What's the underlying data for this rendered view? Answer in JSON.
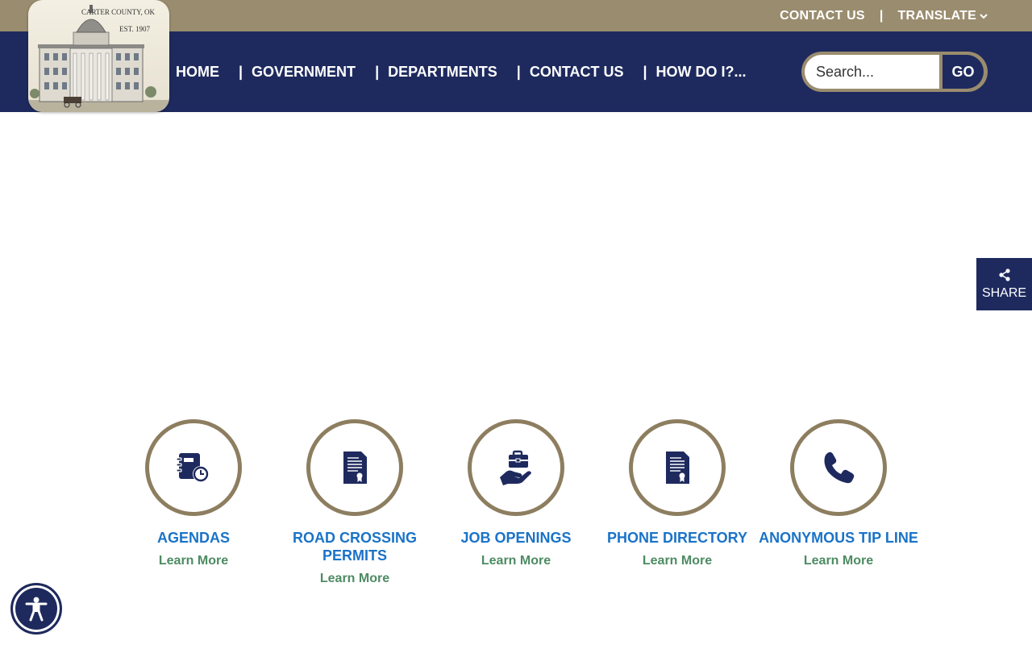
{
  "utility": {
    "contact_label": "CONTACT US",
    "separator": "|",
    "translate_label": "TRANSLATE"
  },
  "logo": {
    "line1": "CARTER COUNTY, OK",
    "line2": "EST. 1907"
  },
  "nav": {
    "separator": "|",
    "items": [
      {
        "label": "HOME"
      },
      {
        "label": "GOVERNMENT"
      },
      {
        "label": "DEPARTMENTS"
      },
      {
        "label": "CONTACT US"
      },
      {
        "label": "HOW DO I?..."
      }
    ]
  },
  "search": {
    "placeholder": "Search...",
    "button_label": "GO"
  },
  "share": {
    "label": "SHARE"
  },
  "quicklinks": [
    {
      "title": "AGENDAS",
      "more": "Learn More",
      "icon": "agenda-clock-icon"
    },
    {
      "title": "ROAD CROSSING PERMITS",
      "more": "Learn More",
      "icon": "certificate-document-icon"
    },
    {
      "title": "JOB OPENINGS",
      "more": "Learn More",
      "icon": "hand-briefcase-icon"
    },
    {
      "title": "PHONE DIRECTORY",
      "more": "Learn More",
      "icon": "certificate-document-icon"
    },
    {
      "title": "ANONYMOUS TIP LINE",
      "more": "Learn More",
      "icon": "phone-icon"
    }
  ],
  "colors": {
    "navy": "#1e2a5e",
    "gold": "#9a8c6e",
    "link_blue": "#1a73c8",
    "learn_green": "#4d8b63"
  }
}
